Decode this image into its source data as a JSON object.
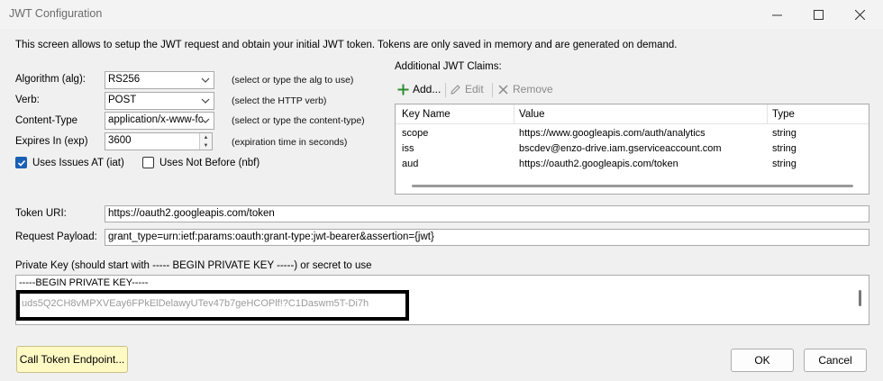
{
  "window": {
    "title": "JWT Configuration"
  },
  "description": "This screen allows to setup the JWT request and obtain your initial JWT token.  Tokens are only saved in memory and are generated on demand.",
  "form": {
    "algorithm": {
      "label": "Algorithm (alg):",
      "value": "RS256",
      "hint": "(select or type the alg to use)"
    },
    "verb": {
      "label": "Verb:",
      "value": "POST",
      "hint": "(select the HTTP verb)"
    },
    "content_type": {
      "label": "Content-Type",
      "value": "application/x-www-fc",
      "hint": "(select or type the content-type)"
    },
    "expires_in": {
      "label": "Expires In (exp)",
      "value": "3600",
      "hint": "(expiration time in seconds)"
    },
    "uses_issues_at": {
      "label": "Uses Issues AT (iat)",
      "checked": true
    },
    "uses_not_before": {
      "label": "Uses Not Before (nbf)",
      "checked": false
    }
  },
  "claims": {
    "title": "Additional JWT Claims:",
    "toolbar": {
      "add": "Add...",
      "edit": "Edit",
      "remove": "Remove"
    },
    "columns": [
      "Key Name",
      "Value",
      "Type"
    ],
    "rows": [
      {
        "key": "scope",
        "value": "https://www.googleapis.com/auth/analytics",
        "type": "string"
      },
      {
        "key": "iss",
        "value": "bscdev@enzo-drive.iam.gserviceaccount.com",
        "type": "string"
      },
      {
        "key": "aud",
        "value": "https://oauth2.googleapis.com/token",
        "type": "string"
      }
    ]
  },
  "token_uri": {
    "label": "Token URI:",
    "value": "https://oauth2.googleapis.com/token"
  },
  "request_payload": {
    "label": "Request Payload:",
    "value": "grant_type=urn:ietf:params:oauth:grant-type:jwt-bearer&assertion={jwt}"
  },
  "private_key": {
    "label": "Private Key (should start with ----- BEGIN PRIVATE KEY -----) or secret to use",
    "first_line": "-----BEGIN PRIVATE KEY-----",
    "partial_line": "uds5Q2CH8vMPXVEay6FPkElDelawyUTev47b7geHCOPlf!?C1Daswm5T-Di7h"
  },
  "buttons": {
    "call_endpoint": "Call Token Endpoint...",
    "ok": "OK",
    "cancel": "Cancel"
  }
}
